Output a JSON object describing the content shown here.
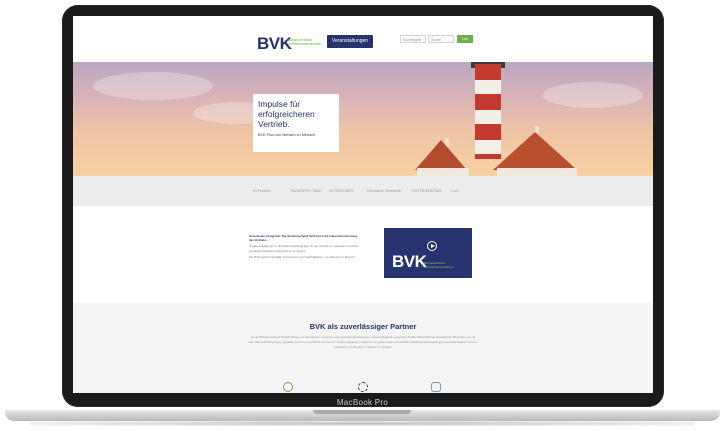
{
  "device": {
    "brand_label": "MacBook Pro"
  },
  "header": {
    "logo": "BVK",
    "logo_subtitle": "Bundesverband Vertriebsunternehmen",
    "events_button": "Veranstaltungen",
    "field_1": "Suchbegriff",
    "field_2": "Suche",
    "go_button": "Los"
  },
  "hero": {
    "title": "Impulse für erfolgreicheren Vertrieb.",
    "subtitle": "BVK Plus von Mensch zu Mensch"
  },
  "partners": [
    "Kl.Partner",
    "BUSINESS TALK",
    "IG PARTNER",
    "Deutsche Vertriebe",
    "VERTRIEBSTAG",
    "CoS"
  ],
  "intro": {
    "heading": "Gemeinsam erfolgreich: Der Bundesverband Vertrieb ist die Interessenvertretung des Vertriebs.",
    "paragraph_1": "Unsere Aufgabe ist es, die Rahmenbedingungen für den Vertrieb zu verbessern und den Austausch zwischen Unternehmen zu fördern.",
    "paragraph_2": "Der BVK steht für Qualität, Transparenz und Nachhaltigkeit – von Mensch zu Mensch."
  },
  "video": {
    "logo": "BVK",
    "subtitle": "Bundesverband Vertriebsunternehmen"
  },
  "partner_section": {
    "title": "BVK als zuverlässiger Partner",
    "body": "Als der Bundesverband Vertrieb bringen wir alle Akteure zusammen und vertreten die Interessen unserer Mitglieder gegenüber Politik, Wirtschaft und Gesellschaft. Wir setzen uns für faire Rahmenbedingungen, Qualität und den persönlichen Kontakt ein. Unsere Mitglieder profitieren von einem starken Netzwerk, exklusiven Veranstaltungen und einer Plattform für den Austausch von Mensch zu Mensch im Vertrieb.",
    "icons": [
      "partner-icon",
      "gear-icon",
      "handshake-icon"
    ]
  },
  "colors": {
    "brand_navy": "#27336e",
    "brand_green": "#6ab04c",
    "lighthouse_red": "#c43a2e"
  }
}
